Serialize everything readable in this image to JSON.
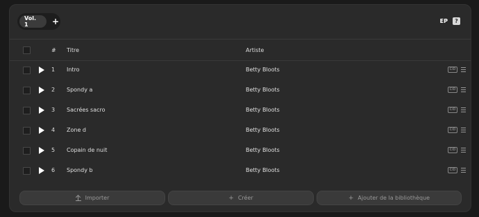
{
  "volume_tabs": {
    "active_label": "Vol. 1",
    "add_label": "+"
  },
  "header_right": {
    "type_label": "EP",
    "help_label": "?"
  },
  "table": {
    "columns": {
      "number": "#",
      "title": "Titre",
      "artist": "Artiste"
    },
    "rows": [
      {
        "num": "1",
        "title": "Intro",
        "artist": "Betty Bloots",
        "badge": "CID"
      },
      {
        "num": "2",
        "title": "Spondy a",
        "artist": "Betty Bloots",
        "badge": "CID"
      },
      {
        "num": "3",
        "title": "Sacrées sacro",
        "artist": "Betty Bloots",
        "badge": "CID"
      },
      {
        "num": "4",
        "title": "Zone d",
        "artist": "Betty Bloots",
        "badge": "CID"
      },
      {
        "num": "5",
        "title": "Copain de nuit",
        "artist": "Betty Bloots",
        "badge": "CID"
      },
      {
        "num": "6",
        "title": "Spondy b",
        "artist": "Betty Bloots",
        "badge": "CID"
      }
    ]
  },
  "footer": {
    "import_label": "Importer",
    "create_label": "Créer",
    "library_label": "Ajouter de la bibliothèque"
  },
  "icons": {
    "play": "play-icon",
    "menu": "drag-handle-icon",
    "upload": "upload-icon",
    "plus": "plus-icon"
  }
}
